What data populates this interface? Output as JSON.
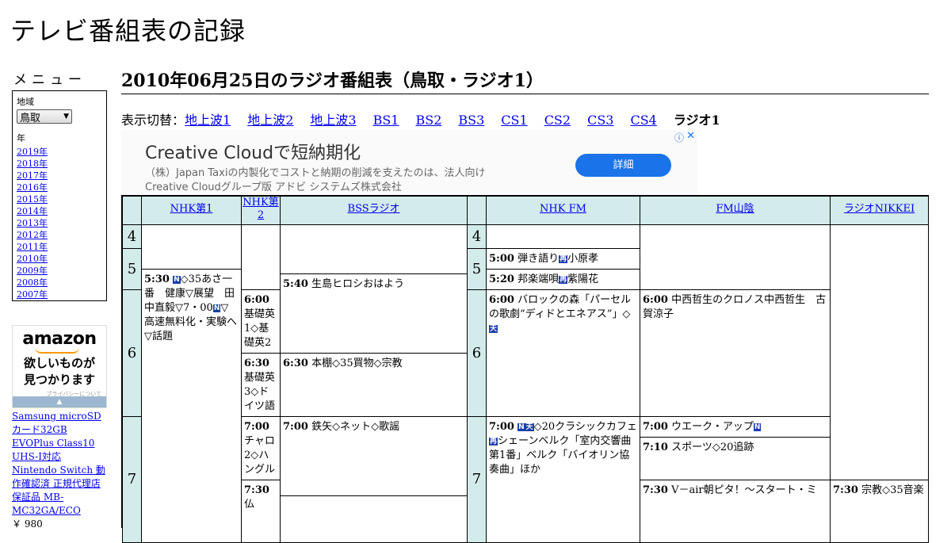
{
  "site": {
    "title": "テレビ番組表の記録"
  },
  "menu": {
    "title": "メニュー",
    "region_label": "地域",
    "region_value": "鳥取",
    "year_label": "年",
    "years": [
      "2019年",
      "2018年",
      "2017年",
      "2016年",
      "2015年",
      "2014年",
      "2013年",
      "2012年",
      "2011年",
      "2010年",
      "2009年",
      "2008年",
      "2007年"
    ]
  },
  "amazon_ad": {
    "logo": "amazon",
    "line1": "欲しいものが",
    "line2": "見つかります",
    "privacy": "プライバシーについて",
    "product": "Samsung microSDカード32GB EVOPlus Class10 UHS-I対応 Nintendo Switch 動作確認済 正規代理店保証品 MB-MC32GA/ECO",
    "price": "￥ 980"
  },
  "page": {
    "title": "2010年06月25日のラジオ番組表（鳥取・ラジオ1）"
  },
  "switcher": {
    "label": "表示切替：",
    "links": [
      "地上波1",
      "地上波2",
      "地上波3",
      "BS1",
      "BS2",
      "BS3",
      "CS1",
      "CS2",
      "CS3",
      "CS4"
    ],
    "current": "ラジオ1"
  },
  "ad": {
    "title": "Creative Cloudで短納期化",
    "text1": "（株）Japan Taxiの内製化でコストと納期の削減を支えたのは、法人向け",
    "text2": "Creative Cloudグループ版 アドビ システムズ株式会社",
    "button": "詳細"
  },
  "schedule": {
    "channels": [
      "NHK第1",
      "NHK第2",
      "BSSラジオ",
      "NHK FM",
      "FM山陰",
      "ラジオNIKKEI"
    ],
    "hours": [
      "4",
      "5",
      "6",
      "7"
    ],
    "programs": {
      "nhk1_0530_time": "5:30",
      "nhk1_0530_text": "◇35あさ一番　健康▽展望　田中直毅▽7・00",
      "nhk1_0530_text2": "▽高速無料化・実験へ▽話題",
      "nhk2_0600_time": "6:00",
      "nhk2_0600_text": "基礎英1◇基礎英2",
      "nhk2_0630_time": "6:30",
      "nhk2_0630_text": "基礎英3◇ドイツ語",
      "nhk2_0700_time": "7:00",
      "nhk2_0700_text": "チャロ2◇ハングル",
      "nhk2_0730_time": "7:30",
      "nhk2_0730_text": "仏",
      "bss_0540_time": "5:40",
      "bss_0540_text": "生島ヒロシおはよう",
      "bss_0630_time": "6:30",
      "bss_0630_text": "本棚◇35買物◇宗教",
      "bss_0700_time": "7:00",
      "bss_0700_text": "鉄矢◇ネット◇歌謡",
      "fm_0500_time": "5:00",
      "fm_0500_text": "弾き語り",
      "fm_0500_text2": "小原孝",
      "fm_0520_time": "5:20",
      "fm_0520_text": "邦楽端唄",
      "fm_0520_text2": "紫陽花",
      "fm_0600_time": "6:00",
      "fm_0600_text": "バロックの森「パーセルの歌劇“ディドとエネアス”」◇",
      "fm_0700_time": "7:00",
      "fm_0700_text": "◇20クラシックカフェ",
      "fm_0700_text2": "シェーンベルク「室内交響曲第1番」ベルク「バイオリン協奏曲」ほか",
      "fms_0600_time": "6:00",
      "fms_0600_text": "中西哲生のクロノス中西哲生　古賀涼子",
      "fms_0700_time": "7:00",
      "fms_0700_text": "ウエーク・アップ",
      "fms_0710_time": "7:10",
      "fms_0710_text": "スポーツ◇20追跡",
      "fms_0730_time": "7:30",
      "fms_0730_text": "V－air朝ピタ！～スタート・ミ",
      "nikkei_0730_time": "7:30",
      "nikkei_0730_text": "宗教◇35音楽"
    },
    "marks": {
      "news": "N",
      "rerun": "再",
      "stereo": "天"
    }
  }
}
